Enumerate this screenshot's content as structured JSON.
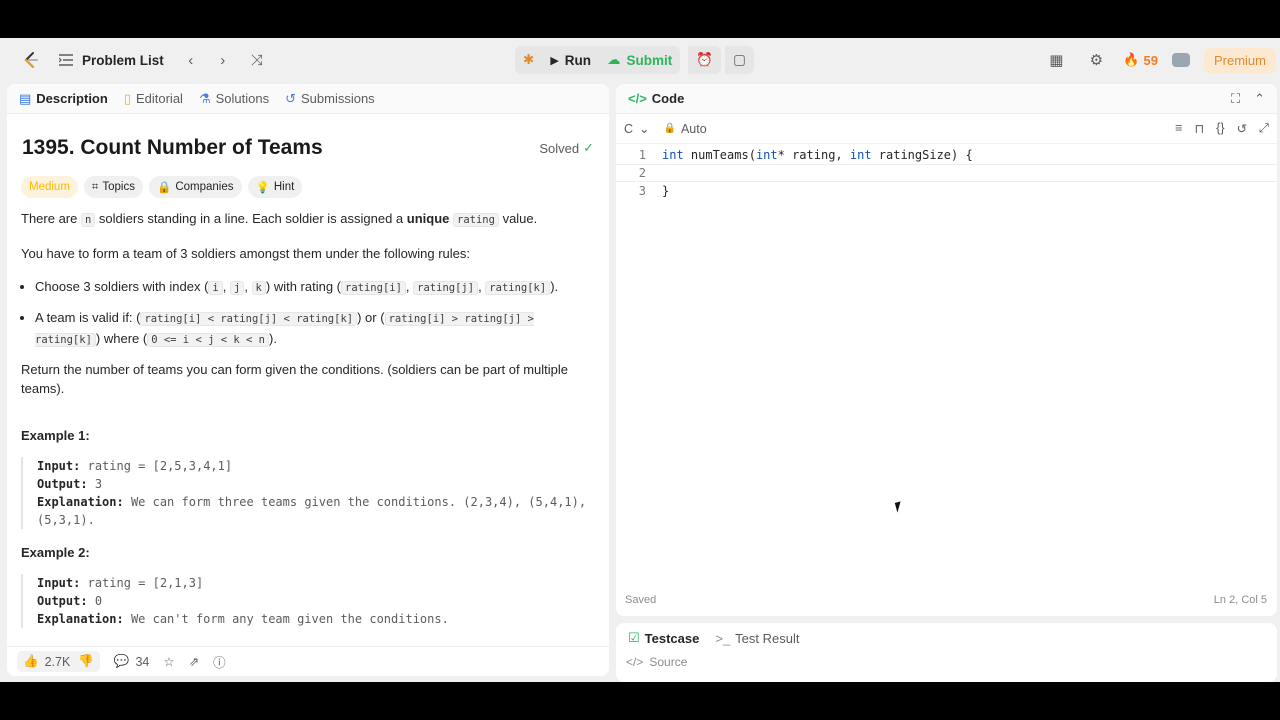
{
  "topbar": {
    "problem_list": "Problem List",
    "run": "Run",
    "submit": "Submit",
    "streak": "59",
    "premium": "Premium"
  },
  "left_tabs": [
    "Description",
    "Editorial",
    "Solutions",
    "Submissions"
  ],
  "problem": {
    "title": "1395. Count Number of Teams",
    "status": "Solved",
    "difficulty": "Medium",
    "tags": [
      "Topics",
      "Companies",
      "Hint"
    ],
    "p1_a": "There are ",
    "p1_code": "n",
    "p1_b": " soldiers standing in a line. Each soldier is assigned a ",
    "p1_bold": "unique",
    "p1_code2": "rating",
    "p1_c": " value.",
    "p2": "You have to form a team of 3 soldiers amongst them under the following rules:",
    "li1_a": "Choose 3 soldiers with index (",
    "li1_i": "i",
    "li1_j": "j",
    "li1_k": "k",
    "li1_b": ") with rating (",
    "li1_ri": "rating[i]",
    "li1_rj": "rating[j]",
    "li1_rk": "rating[k]",
    "li1_c": ").",
    "li2_a": "A team is valid if: (",
    "li2_c1": "rating[i] < rating[j] < rating[k]",
    "li2_b": ") or (",
    "li2_c2": "rating[i] > rating[j] > rating[k]",
    "li2_c": ") where (",
    "li2_c3": "0 <= i < j < k < n",
    "li2_d": ").",
    "p3": "Return the number of teams you can form given the conditions. (soldiers can be part of multiple teams).",
    "examples": [
      {
        "title": "Example 1:",
        "input_label": "Input:",
        "input": "rating = [2,5,3,4,1]",
        "output_label": "Output:",
        "output": "3",
        "expl_label": "Explanation:",
        "expl": "We can form three teams given the conditions. (2,3,4), (5,4,1), (5,3,1)."
      },
      {
        "title": "Example 2:",
        "input_label": "Input:",
        "input": "rating = [2,1,3]",
        "output_label": "Output:",
        "output": "0",
        "expl_label": "Explanation:",
        "expl": "We can't form any team given the conditions."
      }
    ]
  },
  "bottom": {
    "likes": "2.7K",
    "comments": "34"
  },
  "code": {
    "tab": "Code",
    "language": "C",
    "mode": "Auto",
    "lines": [
      {
        "num": "1",
        "text": "int numTeams(int* rating, int ratingSize) {"
      },
      {
        "num": "2",
        "text": ""
      },
      {
        "num": "3",
        "text": "}"
      }
    ],
    "saved": "Saved",
    "position": "Ln 2, Col 5"
  },
  "test_tabs": [
    "Testcase",
    "Test Result"
  ],
  "test_source": "Source"
}
